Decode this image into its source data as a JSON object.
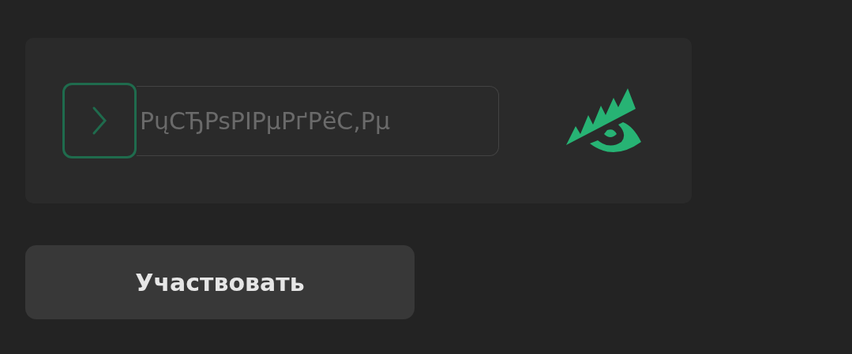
{
  "entry_field": {
    "placeholder": "PųCЂPsPIPµPґPёC,Pµ"
  },
  "submit_button": {
    "label": "Участвовать"
  }
}
